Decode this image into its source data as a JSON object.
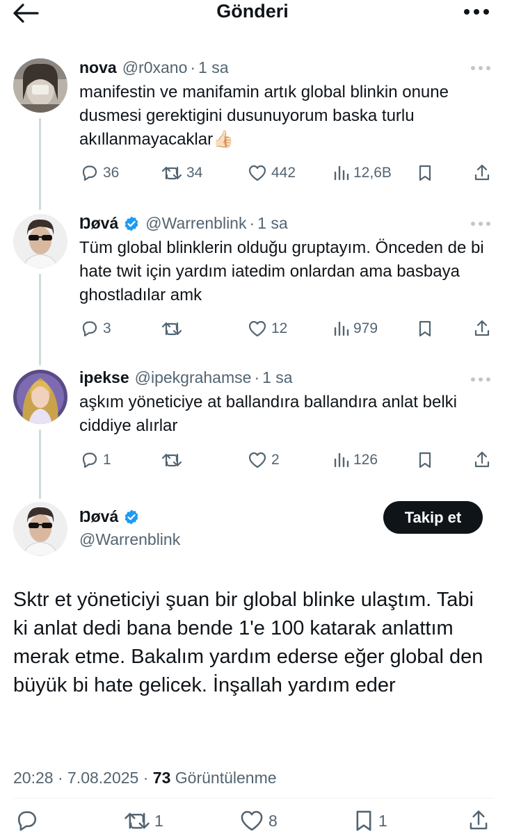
{
  "header": {
    "title": "Gönderi"
  },
  "thread": [
    {
      "name": "nova",
      "handle": "@r0xano",
      "separator": "·",
      "time": "1 sa",
      "verified": false,
      "text": "manifestin ve manifamin artık global blinkin onune dusmesi gerektigini dusunuyorum baska turlu akıllanmayacaklar👍🏻",
      "stats": {
        "replies": "36",
        "retweets": "34",
        "likes": "442",
        "views": "12,6B"
      }
    },
    {
      "name": "Ŋøvá",
      "handle": "@Warrenblink",
      "separator": "·",
      "time": "1 sa",
      "verified": true,
      "text": "Tüm global blinklerin olduğu gruptayım. Önceden de bi hate twit için yardım iatedim onlardan ama basbaya ghostladılar amk",
      "stats": {
        "replies": "3",
        "retweets": "",
        "likes": "12",
        "views": "979"
      }
    },
    {
      "name": "ipekse",
      "handle": "@ipekgrahamse",
      "separator": "·",
      "time": "1 sa",
      "verified": false,
      "text": "aşkım yöneticiye at ballandıra ballandıra anlat belki ciddiye alırlar",
      "stats": {
        "replies": "1",
        "retweets": "",
        "likes": "2",
        "views": "126"
      }
    }
  ],
  "main": {
    "name": "Ŋøvá",
    "handle": "@Warrenblink",
    "follow_label": "Takip et",
    "text": "Sktr et yöneticiyi şuan bir global blinke ulaştım. Tabi ki anlat dedi bana bende 1'e 100 katarak anlattım merak etme. Bakalım yardım ederse eğer global den büyük bi hate gelicek. İnşallah yardım eder",
    "time": "20:28",
    "separator": "·",
    "date": "7.08.2025",
    "views_count": "73",
    "views_label": "Görüntülenme",
    "stats": {
      "retweets": "1",
      "likes": "8",
      "bookmarks": "1"
    }
  },
  "colors": {
    "text": "#0f1419",
    "secondary": "#536471",
    "verified": "#1d9bf0",
    "line": "#cfd9de"
  }
}
